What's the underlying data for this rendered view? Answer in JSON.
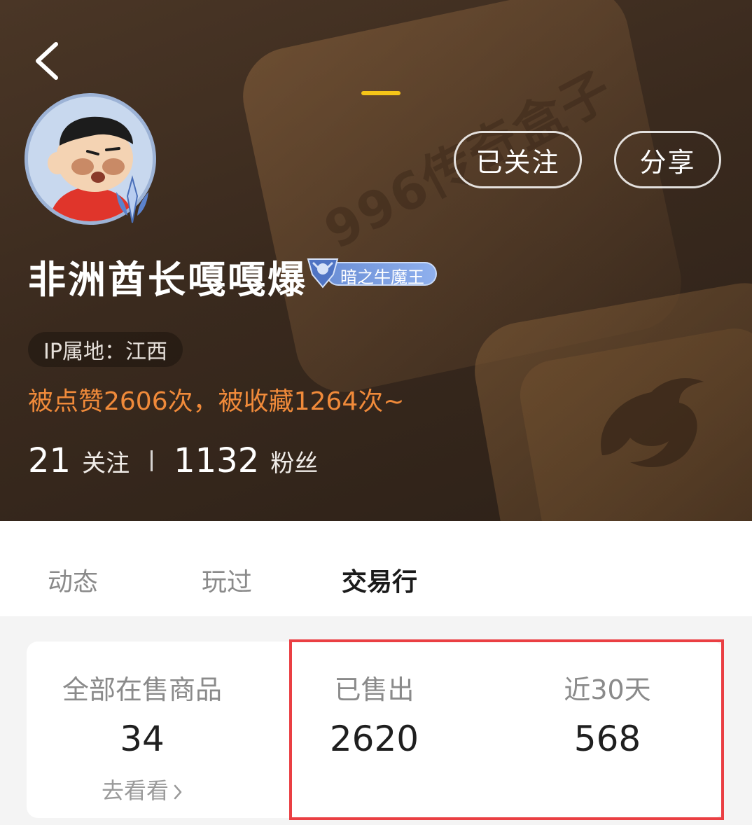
{
  "header": {
    "watermark_text": "996传奇盒子",
    "follow_label": "已关注",
    "share_label": "分享",
    "username": "非洲酋长嘎嘎爆",
    "level_badge": "暗之牛魔王",
    "ip_location": "IP属地：江西",
    "likes_text": "被点赞2606次，被收藏1264次~",
    "following_count": "21",
    "following_label": "关注",
    "followers_count": "1132",
    "followers_label": "粉丝"
  },
  "tabs": [
    {
      "label": "动态",
      "active": false
    },
    {
      "label": "玩过",
      "active": false
    },
    {
      "label": "交易行",
      "active": true
    }
  ],
  "stats": {
    "all_on_sale": {
      "label": "全部在售商品",
      "value": "34",
      "link": "去看看"
    },
    "sold": {
      "label": "已售出",
      "value": "2620"
    },
    "last_30_days": {
      "label": "近30天",
      "value": "568"
    }
  },
  "colors": {
    "accent_orange": "#f08a3a",
    "tab_underline": "#f5c518",
    "highlight_red": "#ea3f43",
    "badge_blue": "#6b8fd6"
  },
  "icons": {
    "back": "back-arrow-icon",
    "link_chevron": "chevron-right-icon",
    "avatar_badge": "sword-badge-icon",
    "level": "bull-demon-badge-icon"
  }
}
